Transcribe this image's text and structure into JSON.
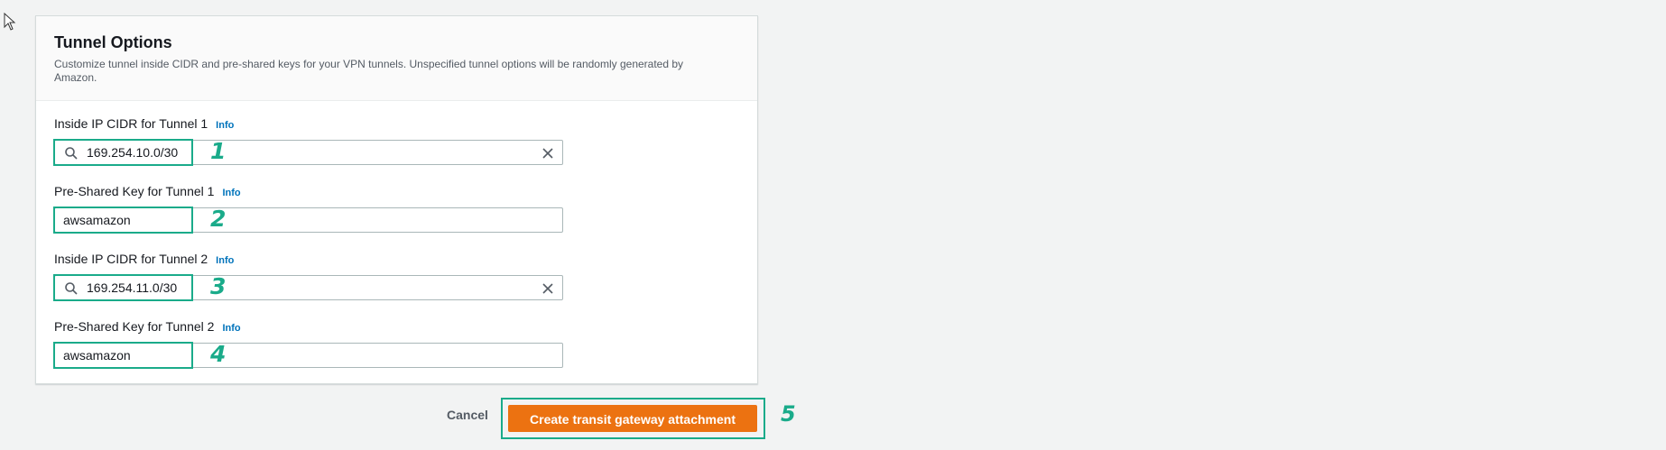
{
  "section": {
    "title": "Tunnel Options",
    "description": "Customize tunnel inside CIDR and pre-shared keys for your VPN tunnels. Unspecified tunnel options will be randomly generated by Amazon."
  },
  "fields": [
    {
      "label": "Inside IP CIDR for Tunnel 1",
      "info": "Info",
      "value": "169.254.10.0/30",
      "step": "1"
    },
    {
      "label": "Pre-Shared Key for Tunnel 1",
      "info": "Info",
      "value": "awsamazon",
      "step": "2"
    },
    {
      "label": "Inside IP CIDR for Tunnel 2",
      "info": "Info",
      "value": "169.254.11.0/30",
      "step": "3"
    },
    {
      "label": "Pre-Shared Key for Tunnel 2",
      "info": "Info",
      "value": "awsamazon",
      "step": "4"
    }
  ],
  "actions": {
    "cancel_label": "Cancel",
    "submit_label": "Create transit gateway attachment",
    "submit_step": "5"
  },
  "colors": {
    "primary": "#ec7211",
    "highlight": "#1aab8a",
    "link": "#0073bb"
  },
  "icons": {
    "search": "search-icon",
    "clear": "close-icon",
    "cursor": "cursor-arrow-icon"
  }
}
